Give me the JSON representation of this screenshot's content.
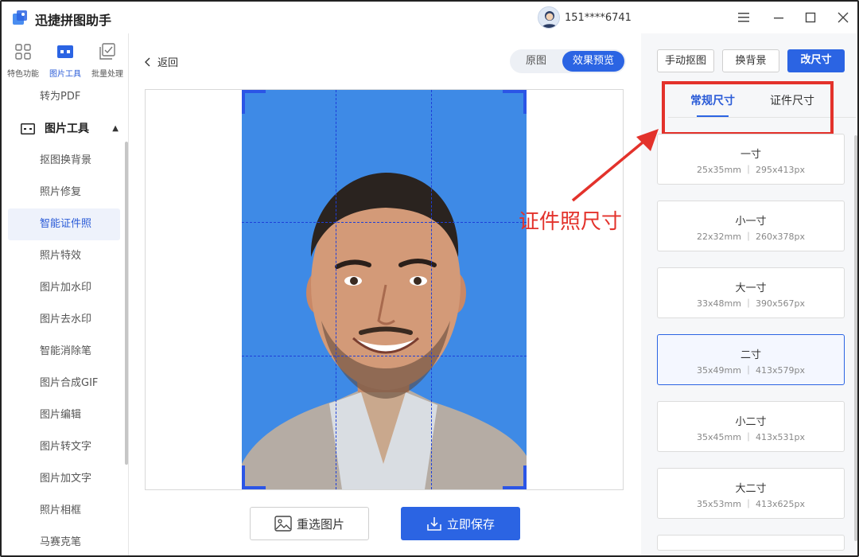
{
  "app": {
    "title": "迅捷拼图助手",
    "user_phone": "151****6741"
  },
  "sidebar": {
    "top": [
      {
        "label": "特色功能",
        "icon": "grid-icon"
      },
      {
        "label": "图片工具",
        "icon": "image-tool-icon"
      },
      {
        "label": "批量处理",
        "icon": "batch-icon"
      }
    ],
    "items_before": [
      "转为PDF"
    ],
    "group": {
      "label": "图片工具"
    },
    "items": [
      "抠图换背景",
      "照片修复",
      "智能证件照",
      "照片特效",
      "图片加水印",
      "图片去水印",
      "智能消除笔",
      "图片合成GIF",
      "图片编辑",
      "图片转文字",
      "图片加文字",
      "照片相框",
      "马赛克笔"
    ]
  },
  "center": {
    "back_label": "返回",
    "toggle": {
      "original": "原图",
      "preview": "效果预览"
    },
    "reselect_label": "重选图片",
    "save_label": "立即保存",
    "annotation": "证件照尺寸"
  },
  "right": {
    "buttons": {
      "manual_cutout": "手动抠图",
      "change_bg": "换背景",
      "resize": "改尺寸"
    },
    "tabs": {
      "regular": "常规尺寸",
      "id": "证件尺寸"
    },
    "sizes": [
      {
        "name": "一寸",
        "spec": "25x35mm ｜ 295x413px"
      },
      {
        "name": "小一寸",
        "spec": "22x32mm ｜ 260x378px"
      },
      {
        "name": "大一寸",
        "spec": "33x48mm ｜ 390x567px"
      },
      {
        "name": "二寸",
        "spec": "35x49mm ｜ 413x579px"
      },
      {
        "name": "小二寸",
        "spec": "35x45mm ｜ 413x531px"
      },
      {
        "name": "大二寸",
        "spec": "35x53mm ｜ 413x625px"
      }
    ]
  },
  "colors": {
    "accent": "#2b64e3",
    "photo_bg": "#3e8ae6",
    "annotation": "#e3322b"
  }
}
